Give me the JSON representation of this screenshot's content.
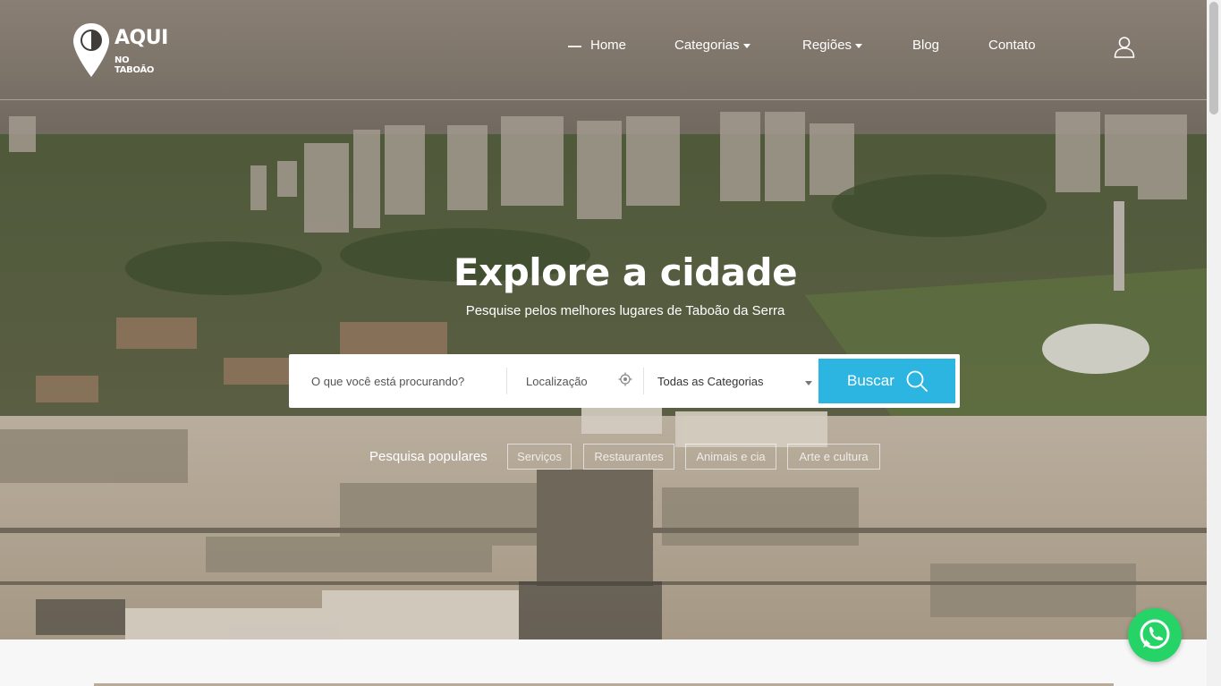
{
  "header": {
    "logo": {
      "title": "AQUI",
      "subtitle": "NO TABOÃO"
    },
    "nav": {
      "home": "Home",
      "categorias": "Categorias",
      "regioes": "Regiões",
      "blog": "Blog",
      "contato": "Contato"
    },
    "icons": {
      "user": "user-icon"
    }
  },
  "hero": {
    "title": "Explore a cidade",
    "subtitle": "Pesquise pelos melhores lugares de Taboão da Serra"
  },
  "search": {
    "what_placeholder": "O que você está procurando?",
    "location_placeholder": "Localização",
    "category_selected": "Todas as Categorias",
    "button_label": "Buscar",
    "accent_color": "#2cb5e1"
  },
  "popular": {
    "label": "Pesquisa populares",
    "chips": [
      "Serviços",
      "Restaurantes",
      "Animais e cia",
      "Arte e cultura"
    ]
  },
  "floating": {
    "whatsapp": "whatsapp-icon",
    "color": "#25d366"
  }
}
